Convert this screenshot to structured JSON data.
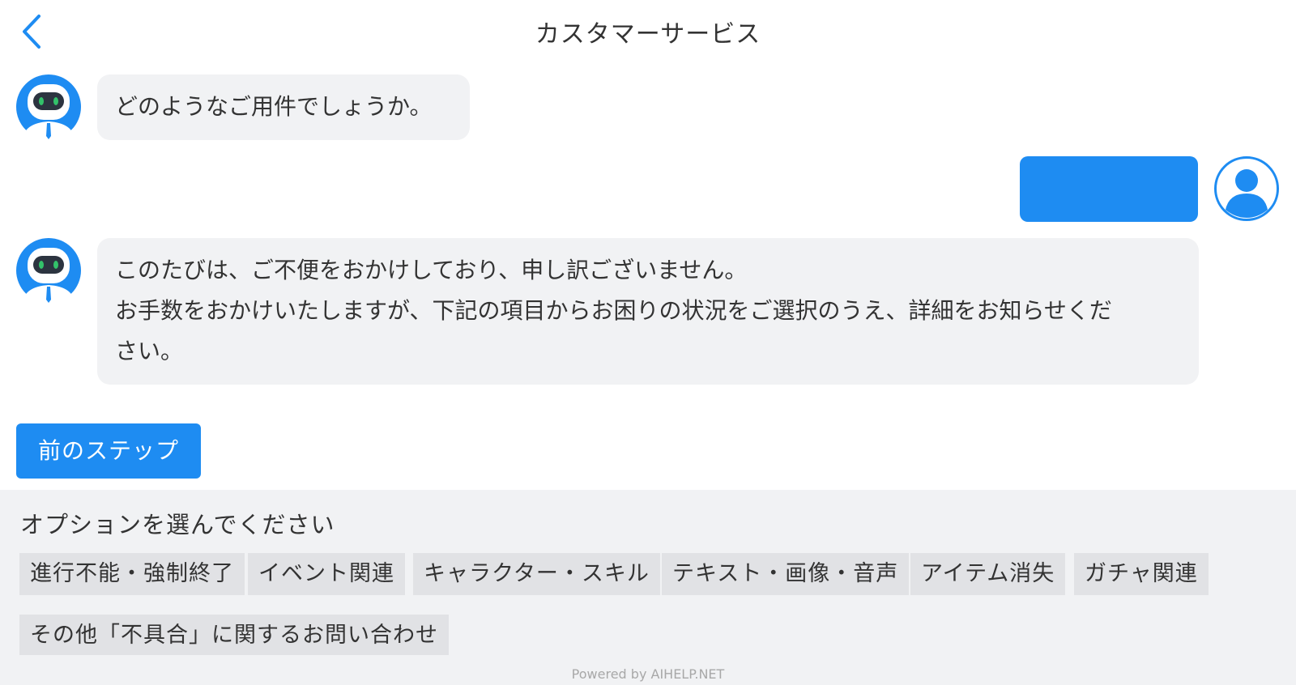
{
  "header": {
    "title": "カスタマーサービス"
  },
  "messages": {
    "bot_greeting": "どのようなご用件でしょうか。",
    "bot_apology_line1": "このたびは、ご不便をおかけしており、申し訳ございません。",
    "bot_apology_line2": "お手数をおかけいたしますが、下記の項目からお困りの状況をご選択のうえ、詳細をお知らせくだ",
    "bot_apology_line3": "さい。"
  },
  "prev_step_label": "前のステップ",
  "options_panel": {
    "title": "オプションを選んでください",
    "options": [
      "進行不能・強制終了",
      "イベント関連",
      "キャラクター・スキル",
      "テキスト・画像・音声",
      "アイテム消失",
      "ガチャ関連",
      "その他「不具合」に関するお問い合わせ"
    ],
    "powered_by": "Powered by AIHELP.NET"
  },
  "colors": {
    "accent": "#1e8cf2",
    "bubble_bg": "#f1f2f4",
    "chip_bg": "#e1e2e5"
  },
  "icons": {
    "back": "chevron-left-icon",
    "bot_avatar": "robot-avatar-icon",
    "user_avatar": "user-avatar-icon"
  }
}
